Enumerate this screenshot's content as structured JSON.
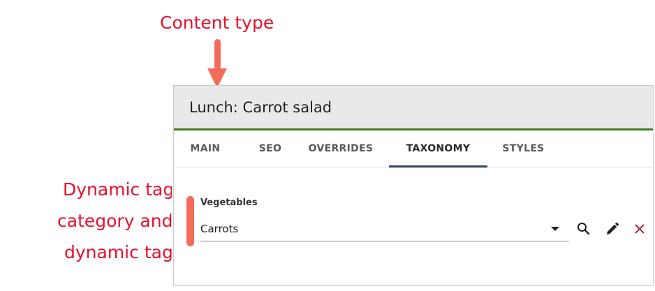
{
  "annotations": {
    "content_type": "Content type",
    "line1": "Dynamic tag",
    "line2": "category and",
    "line3": "dynamic tag"
  },
  "panel": {
    "title": "Lunch: Carrot salad",
    "tabs": [
      {
        "label": "MAIN"
      },
      {
        "label": "SEO"
      },
      {
        "label": "OVERRIDES"
      },
      {
        "label": "TAXONOMY",
        "active": true
      },
      {
        "label": "STYLES"
      }
    ]
  },
  "field": {
    "label": "Vegetables",
    "value": "Carrots"
  },
  "icons": {
    "search": "search-icon",
    "edit": "pencil-icon",
    "remove": "close-icon"
  },
  "colors": {
    "annotation": "#e8112d",
    "header_accent": "#3d7d1a",
    "active_tab": "#3a4a66",
    "remove_icon": "#b0283a"
  }
}
